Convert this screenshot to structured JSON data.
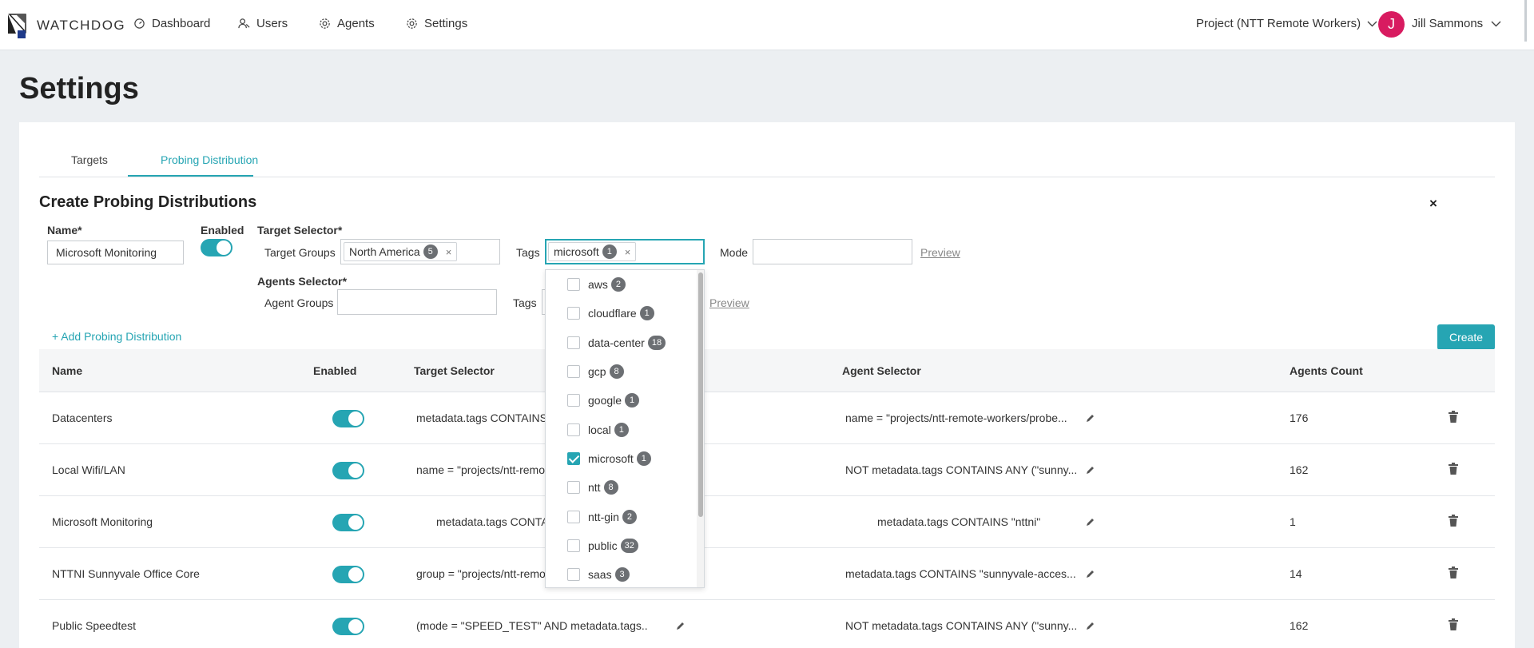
{
  "app": {
    "brand": "WATCHDOG"
  },
  "nav": {
    "items": [
      {
        "label": "Dashboard",
        "icon": "dashboard-icon"
      },
      {
        "label": "Users",
        "icon": "users-icon"
      },
      {
        "label": "Agents",
        "icon": "gear-icon"
      },
      {
        "label": "Settings",
        "icon": "gear-icon"
      }
    ],
    "project": "Project (NTT Remote Workers)",
    "user": {
      "initial": "J",
      "name": "Jill Sammons",
      "avatar_color": "#d81b60"
    }
  },
  "page": {
    "title": "Settings"
  },
  "tabs": [
    {
      "label": "Targets",
      "active": false
    },
    {
      "label": "Probing Distribution",
      "active": true
    }
  ],
  "form": {
    "title": "Create Probing Distributions",
    "close": "×",
    "name_label": "Name*",
    "name_value": "Microsoft Monitoring",
    "enabled_label": "Enabled",
    "target_selector_label": "Target Selector*",
    "target_groups_label": "Target Groups",
    "target_group_chip": {
      "label": "North America",
      "count": "5"
    },
    "tags_label": "Tags",
    "tag_chip": {
      "label": "microsoft",
      "count": "1"
    },
    "mode_label": "Mode",
    "preview_label": "Preview",
    "agents_selector_label": "Agents Selector*",
    "agent_groups_label": "Agent Groups",
    "agent_tags_label": "Tags",
    "agent_preview_label": "Preview",
    "add_link": "+ Add Probing Distribution",
    "create_button": "Create"
  },
  "tag_options": [
    {
      "label": "aws",
      "count": "2",
      "checked": false
    },
    {
      "label": "cloudflare",
      "count": "1",
      "checked": false
    },
    {
      "label": "data-center",
      "count": "18",
      "checked": false
    },
    {
      "label": "gcp",
      "count": "8",
      "checked": false
    },
    {
      "label": "google",
      "count": "1",
      "checked": false
    },
    {
      "label": "local",
      "count": "1",
      "checked": false
    },
    {
      "label": "microsoft",
      "count": "1",
      "checked": true
    },
    {
      "label": "ntt",
      "count": "8",
      "checked": false
    },
    {
      "label": "ntt-gin",
      "count": "2",
      "checked": false
    },
    {
      "label": "public",
      "count": "32",
      "checked": false
    },
    {
      "label": "saas",
      "count": "3",
      "checked": false
    }
  ],
  "table": {
    "headers": {
      "name": "Name",
      "enabled": "Enabled",
      "target": "Target Selector",
      "agent": "Agent Selector",
      "count": "Agents Count"
    },
    "rows": [
      {
        "name": "Datacenters",
        "target": "metadata.tags CONTAINS",
        "agent": "name = \"projects/ntt-remote-workers/probe...",
        "count": "176"
      },
      {
        "name": "Local Wifi/LAN",
        "target": "name = \"projects/ntt-remo",
        "agent": "NOT metadata.tags CONTAINS ANY (\"sunny...",
        "count": "162"
      },
      {
        "name": "Microsoft Monitoring",
        "target": "metadata.tags CONTA",
        "agent": "metadata.tags CONTAINS \"nttni\"",
        "count": "1"
      },
      {
        "name": "NTTNI Sunnyvale Office Core",
        "target": "group = \"projects/ntt-remo",
        "agent": "metadata.tags CONTAINS \"sunnyvale-acces...",
        "count": "14"
      },
      {
        "name": "Public Speedtest",
        "target": "(mode = \"SPEED_TEST\" AND metadata.tags...",
        "agent": "NOT metadata.tags CONTAINS ANY (\"sunny...",
        "count": "162"
      }
    ]
  },
  "colors": {
    "accent": "#26a5b3",
    "badge": "#6c6f73"
  }
}
